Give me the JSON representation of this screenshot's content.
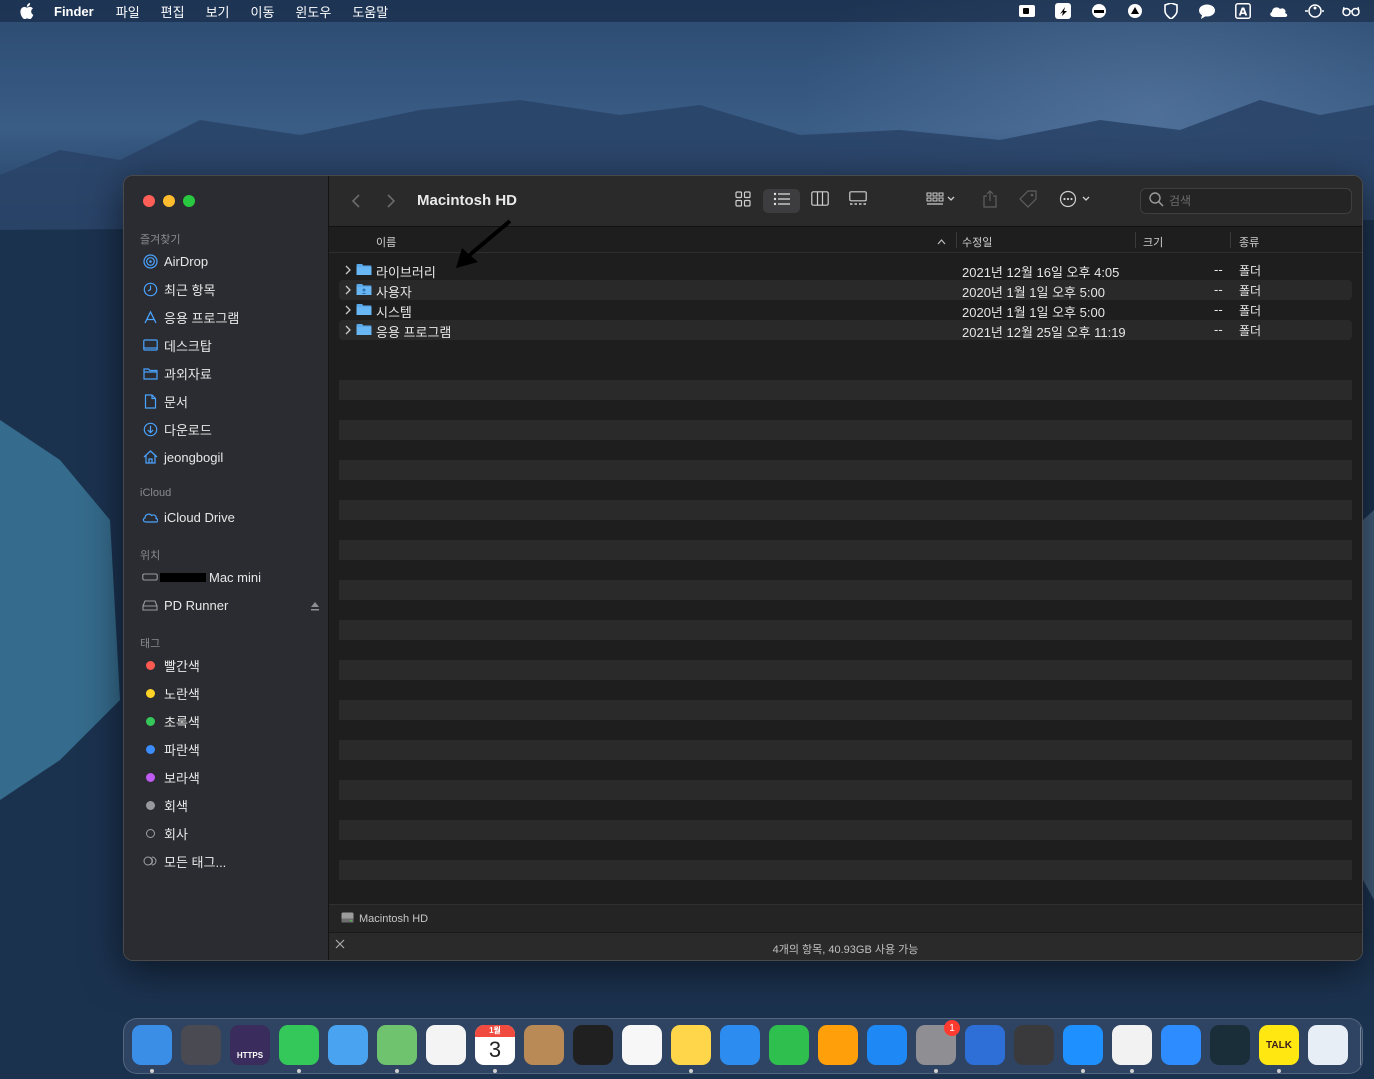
{
  "menubar": {
    "app_name": "Finder",
    "items": [
      "파일",
      "편집",
      "보기",
      "이동",
      "윈도우",
      "도움말"
    ],
    "status_icons": [
      "video-recorder-icon",
      "creative-cloud-icon",
      "turtle-icon",
      "vpn-icon",
      "shield-icon",
      "chat-bubble-icon",
      "input-source-icon",
      "cloud-icon",
      "accessibility-icon",
      "glasses-icon"
    ]
  },
  "window": {
    "title": "Macintosh HD",
    "search_placeholder": "검색",
    "sidebar": {
      "favorites_label": "즐겨찾기",
      "favorites": [
        {
          "label": "AirDrop",
          "icon": "airdrop-icon"
        },
        {
          "label": "최근 항목",
          "icon": "clock-icon"
        },
        {
          "label": "응용 프로그램",
          "icon": "applications-icon"
        },
        {
          "label": "데스크탑",
          "icon": "desktop-icon"
        },
        {
          "label": "과외자료",
          "icon": "folder-icon"
        },
        {
          "label": "문서",
          "icon": "document-icon"
        },
        {
          "label": "다운로드",
          "icon": "download-icon"
        },
        {
          "label": "jeongbogil",
          "icon": "home-icon"
        }
      ],
      "icloud_label": "iCloud",
      "icloud": [
        {
          "label": "iCloud Drive",
          "icon": "icloud-icon"
        }
      ],
      "locations_label": "위치",
      "locations": [
        {
          "label": "Mac mini",
          "icon": "mac-mini-icon"
        },
        {
          "label": "PD Runner",
          "icon": "disk-icon"
        }
      ],
      "tags_label": "태그",
      "tags": [
        {
          "label": "빨간색",
          "color": "#ff5a52"
        },
        {
          "label": "노란색",
          "color": "#ffd426"
        },
        {
          "label": "초록색",
          "color": "#35c759"
        },
        {
          "label": "파란색",
          "color": "#3b8cff"
        },
        {
          "label": "보라색",
          "color": "#bf5af2"
        },
        {
          "label": "회색",
          "color": "#98989d"
        },
        {
          "label": "회사",
          "color": ""
        },
        {
          "label": "모든 태그...",
          "color": ""
        }
      ]
    },
    "columns": {
      "name": "이름",
      "modified": "수정일",
      "size": "크기",
      "kind": "종류"
    },
    "files": [
      {
        "name": "라이브러리",
        "modified": "2021년 12월 16일 오후 4:05",
        "size": "--",
        "kind": "폴더"
      },
      {
        "name": "사용자",
        "modified": "2020년 1월 1일 오후 5:00",
        "size": "--",
        "kind": "폴더"
      },
      {
        "name": "시스템",
        "modified": "2020년 1월 1일 오후 5:00",
        "size": "--",
        "kind": "폴더"
      },
      {
        "name": "응용 프로그램",
        "modified": "2021년 12월 25일 오후 11:19",
        "size": "--",
        "kind": "폴더"
      }
    ],
    "path_bar": "Macintosh HD",
    "status": "4개의 항목, 40.93GB 사용 가능"
  },
  "dock": {
    "apps": [
      {
        "name": "finder-icon",
        "color": "#3a8ee6"
      },
      {
        "name": "launchpad-icon",
        "color": "#4a4a52"
      },
      {
        "name": "https-app-icon",
        "color": "#3a2c5c",
        "label": "HTTPS"
      },
      {
        "name": "messages-icon",
        "color": "#34c759"
      },
      {
        "name": "mail-icon",
        "color": "#4aa3f0"
      },
      {
        "name": "maps-icon",
        "color": "#6fc36f"
      },
      {
        "name": "photos-icon",
        "color": "#f4f4f4"
      },
      {
        "name": "calendar-icon",
        "color": "#ffffff",
        "label": "3",
        "month": "1월"
      },
      {
        "name": "contacts-icon",
        "color": "#b98a55"
      },
      {
        "name": "piano-icon",
        "color": "#202020"
      },
      {
        "name": "reminders-icon",
        "color": "#f7f7f7"
      },
      {
        "name": "notes-icon",
        "color": "#ffd54a"
      },
      {
        "name": "keynote-icon",
        "color": "#2d8cf0"
      },
      {
        "name": "numbers-icon",
        "color": "#2fbf4f"
      },
      {
        "name": "pages-icon",
        "color": "#ff9f0a"
      },
      {
        "name": "app-store-icon",
        "color": "#1e88f5"
      },
      {
        "name": "system-preferences-icon",
        "color": "#8e8e93",
        "badge": "1"
      },
      {
        "name": "stack-app-icon",
        "color": "#2d6fd6"
      },
      {
        "name": "disk-utility-icon",
        "color": "#3a3a3c"
      },
      {
        "name": "safari-icon",
        "color": "#1e90ff"
      },
      {
        "name": "textedit-icon",
        "color": "#f2f2f2"
      },
      {
        "name": "zoom-icon",
        "color": "#2d8cff"
      },
      {
        "name": "league-of-legends-icon",
        "color": "#1a2e3a"
      },
      {
        "name": "kakaotalk-icon",
        "color": "#ffe812",
        "label": "TALK"
      },
      {
        "name": "preview-icon",
        "color": "#e8eef5"
      }
    ]
  }
}
